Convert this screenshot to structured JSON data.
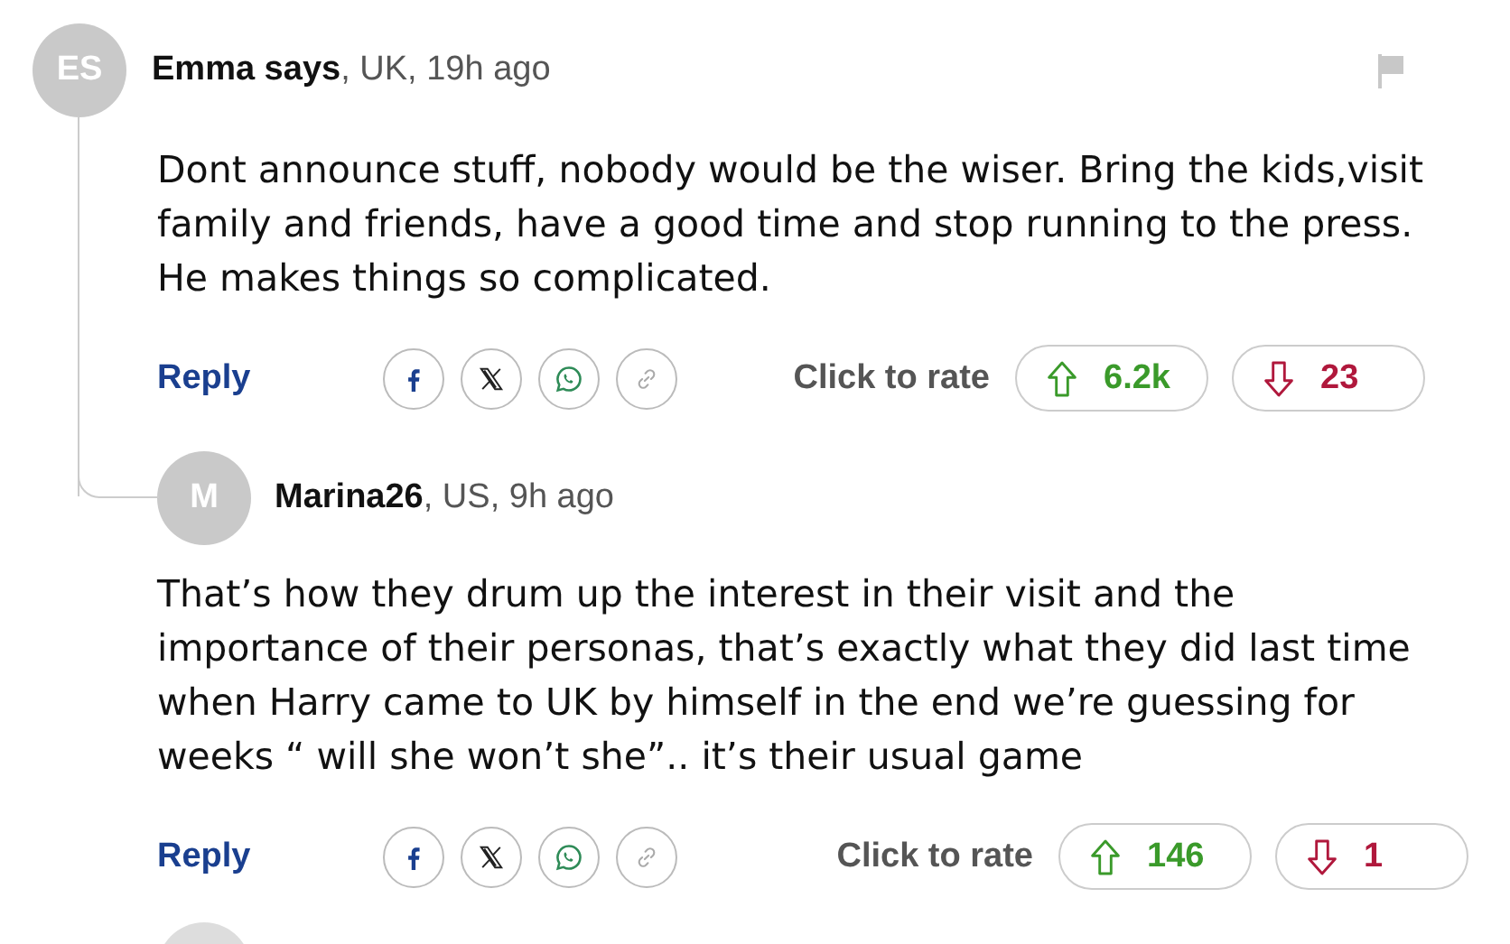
{
  "comments": [
    {
      "initials": "ES",
      "author": "Emma says",
      "meta": ", UK, 19h ago",
      "flag": true,
      "text": "Dont announce stuff, nobody would be the wiser. Bring the kids,visit family and friends, have a good time and stop running to the press. He makes things so complicated.",
      "reply_label": "Reply",
      "rate_label": "Click to rate",
      "up": "6.2k",
      "down": "23",
      "replies": [
        {
          "initials": "M",
          "author": "Marina26",
          "meta": ", US, 9h ago",
          "flag": false,
          "text": "That’s how they drum up the interest in their visit and the importance of their personas, that’s exactly what they did last time when Harry came to UK by himself in the end we’re guessing for weeks “ will she won’t she”.. it’s their usual game",
          "reply_label": "Reply",
          "rate_label": "Click to rate",
          "up": "146",
          "down": "1"
        }
      ]
    }
  ]
}
